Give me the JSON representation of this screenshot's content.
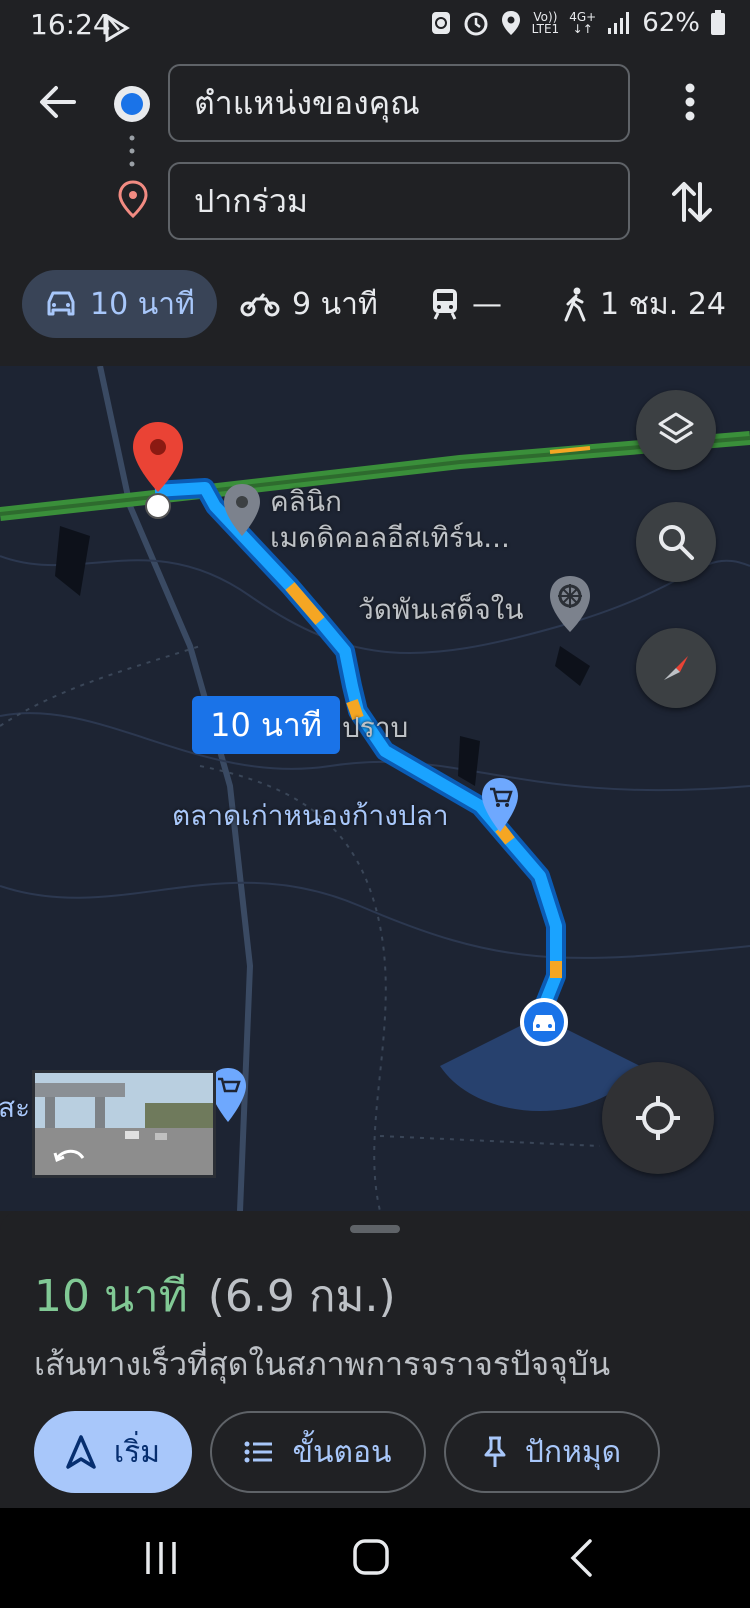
{
  "status_bar": {
    "time": "16:24",
    "network_top": "Vo))",
    "network_bottom": "LTE1",
    "data_top": "4G+",
    "battery": "62%"
  },
  "directions": {
    "origin": "ตำแหน่งของคุณ",
    "destination": "ปากร่วม"
  },
  "modes": [
    {
      "icon": "car-icon",
      "label": "10 นาที"
    },
    {
      "icon": "motorcycle-icon",
      "label": "9 นาที"
    },
    {
      "icon": "transit-icon",
      "label": "—"
    },
    {
      "icon": "walk-icon",
      "label": "1 ชม. 24"
    }
  ],
  "map": {
    "route_time_label": "10 นาที",
    "places": {
      "clinic_line1": "คลินิก",
      "clinic_line2": "เมดดิคอลอีสเทิร์น...",
      "temple": "วัดพันเสด็จใน",
      "prap": "ปราบ",
      "market": "ตลาดเก่าหนองก้างปลา",
      "edge": "สะ"
    },
    "colors": {
      "route": "#1aa3ff",
      "traffic_slow": "#f5a623",
      "highway": "#3a8f3a",
      "destination_pin": "#ea4335"
    }
  },
  "route_summary": {
    "duration": "10 นาที",
    "distance": "(6.9 กม.)",
    "description": "เส้นทางเร็วที่สุดในสภาพการจราจรปัจจุบัน",
    "start_label": "เริ่ม",
    "steps_label": "ขั้นตอน",
    "pin_label": "ปักหมุด",
    "duration_color": "#81c995",
    "accent": "#a8c7fa"
  }
}
